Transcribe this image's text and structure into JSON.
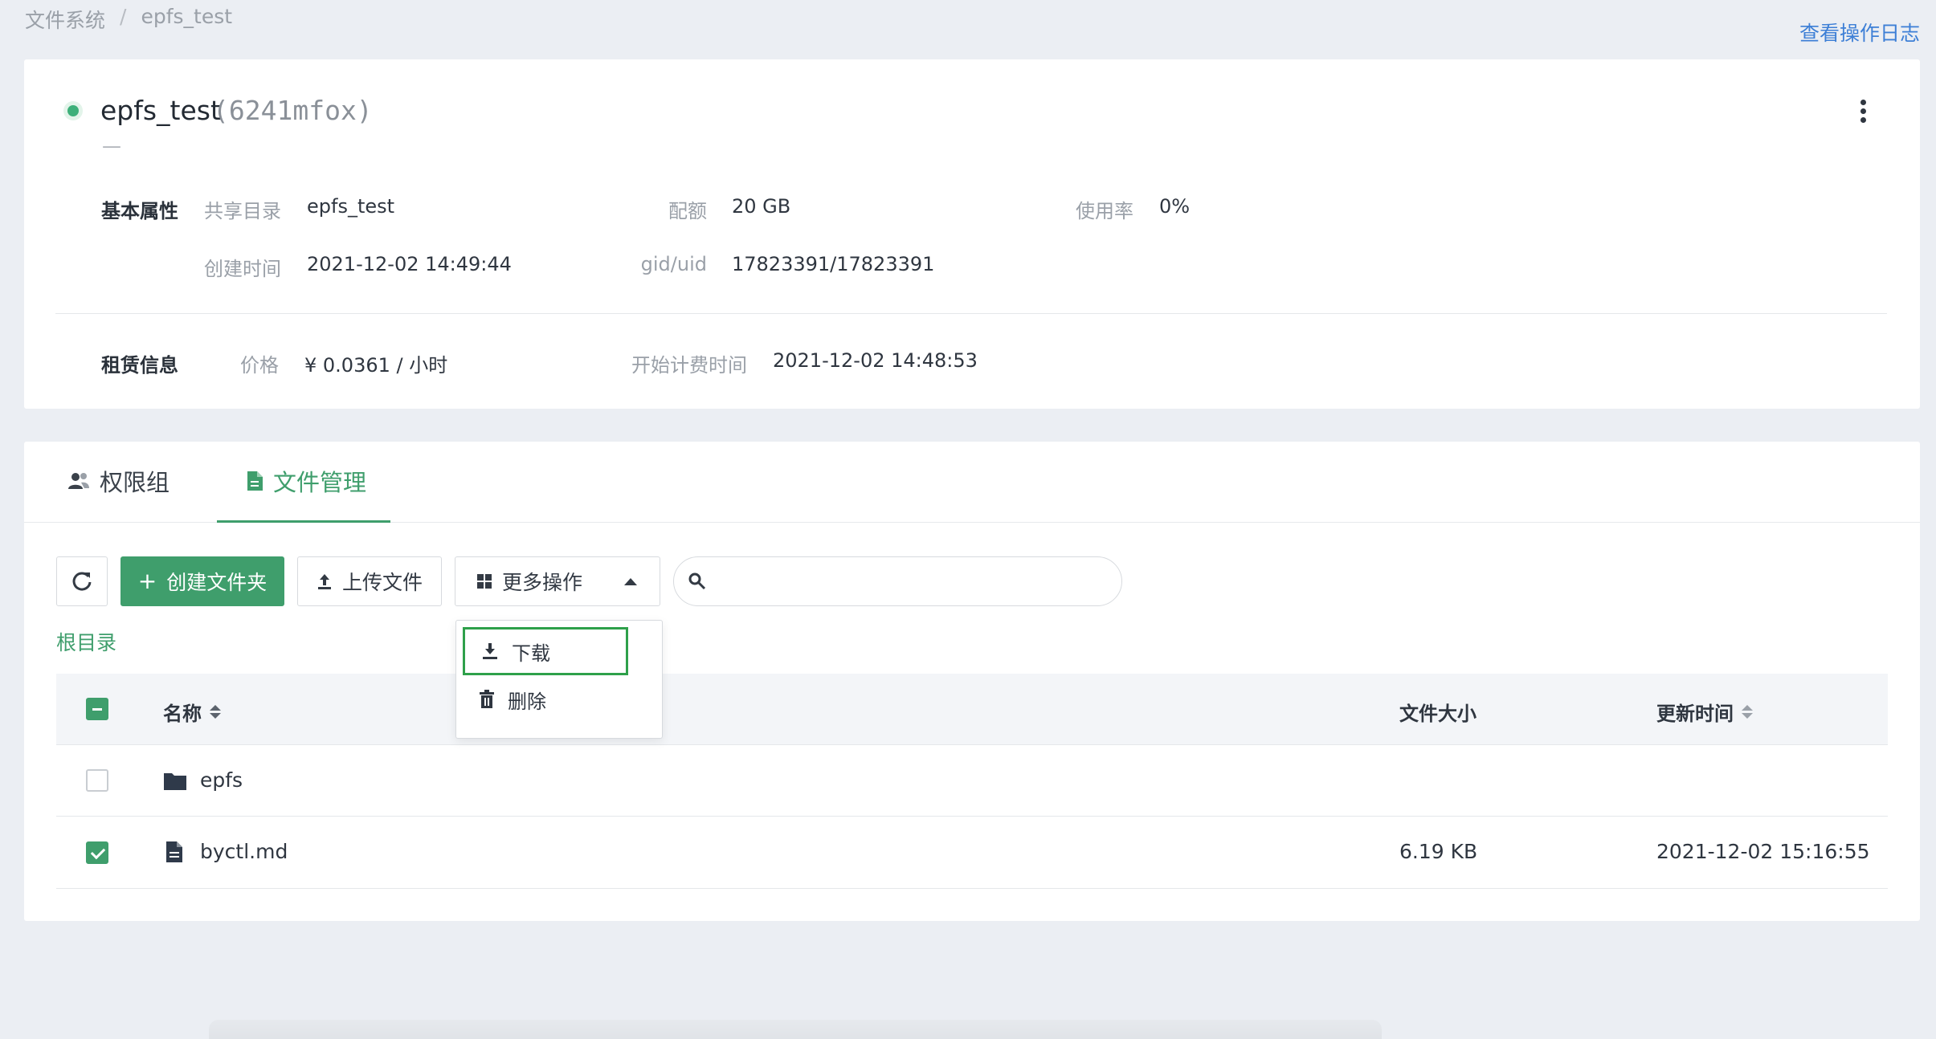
{
  "breadcrumb": {
    "root": "文件系统",
    "sep": "/",
    "current": "epfs_test"
  },
  "header": {
    "op_log": "查看操作日志"
  },
  "fs": {
    "name": "epfs_test",
    "id": "(6241mfox)",
    "desc": "—"
  },
  "basic": {
    "title": "基本属性",
    "share_dir_label": "共享目录",
    "share_dir": "epfs_test",
    "quota_label": "配额",
    "quota": "20 GB",
    "usage_label": "使用率",
    "usage": "0%",
    "created_label": "创建时间",
    "created": "2021-12-02 14:49:44",
    "gid_label": "gid/uid",
    "gid": "17823391/17823391"
  },
  "rent": {
    "title": "租赁信息",
    "price_label": "价格",
    "price": "¥ 0.0361 / 小时",
    "billing_label": "开始计费时间",
    "billing": "2021-12-02 14:48:53"
  },
  "tabs": [
    {
      "label": "权限组"
    },
    {
      "label": "文件管理"
    }
  ],
  "toolbar": {
    "create": "创建文件夹",
    "upload": "上传文件",
    "more": "更多操作",
    "search_placeholder": ""
  },
  "root_link": "根目录",
  "table": {
    "col_name": "名称",
    "col_size": "文件大小",
    "col_time": "更新时间",
    "rows": [
      {
        "name": "epfs",
        "size": "",
        "time": ""
      },
      {
        "name": "byctl.md",
        "size": "6.19 KB",
        "time": "2021-12-02 15:16:55"
      }
    ]
  },
  "dropdown": {
    "download": "下载",
    "delete": "删除"
  },
  "colors": {
    "accent": "#3f9e6c",
    "link": "#3d7fd6",
    "highlight": "#2ea04a"
  }
}
